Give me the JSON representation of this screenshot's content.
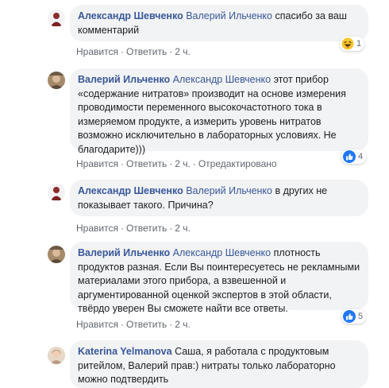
{
  "comments": [
    {
      "author": "Александр Шевченко",
      "mention": "Валерий Ильченко",
      "text": " спасибо за ваш комментарий",
      "like": "Нравится",
      "reply": "Ответить",
      "time": "2 ч.",
      "reaction": {
        "icon": "haha-emoji-icon",
        "count": "1"
      }
    },
    {
      "author": "Валерий Ильченко",
      "mention": "Александр Шевченко",
      "text": " этот прибор «содержание нитратов» производит на основе измерения проводимости переменного высокочастотного тока в измеряемом продукте, а измерить уровень нитратов возможно исключительно в лабораторных условиях. Не благодарите)))",
      "like": "Нравится",
      "reply": "Ответить",
      "time": "2 ч.",
      "edited": "Отредактировано",
      "reaction": {
        "icon": "like-thumb-icon",
        "count": "4"
      }
    },
    {
      "author": "Александр Шевченко",
      "mention": "Валерий Ильченко",
      "text": " в других не показывает такого. Причина?",
      "like": "Нравится",
      "reply": "Ответить",
      "time": "2 ч."
    },
    {
      "author": "Валерий Ильченко",
      "mention": "Александр Шевченко",
      "text": " плотность продуктов разная. Если Вы поинтересуетесь не рекламными материалами этого прибора, а взвешенной и аргументированной оценкой экспертов в этой области, твёрдо уверен Вы сможете найти все ответы.",
      "like": "Нравится",
      "reply": "Ответить",
      "time": "2 ч.",
      "reaction": {
        "icon": "like-thumb-icon",
        "count": "5"
      }
    },
    {
      "author": "Katerina Yelmanova",
      "text": " Саша, я работала с продуктовым ритейлом, Валерий прав:) нитраты только лабораторно можно подтвердить"
    }
  ],
  "colors": {
    "link": "#385898",
    "bubble": "#f2f3f5",
    "meta": "#606770",
    "like_blue": "#2078f4"
  }
}
